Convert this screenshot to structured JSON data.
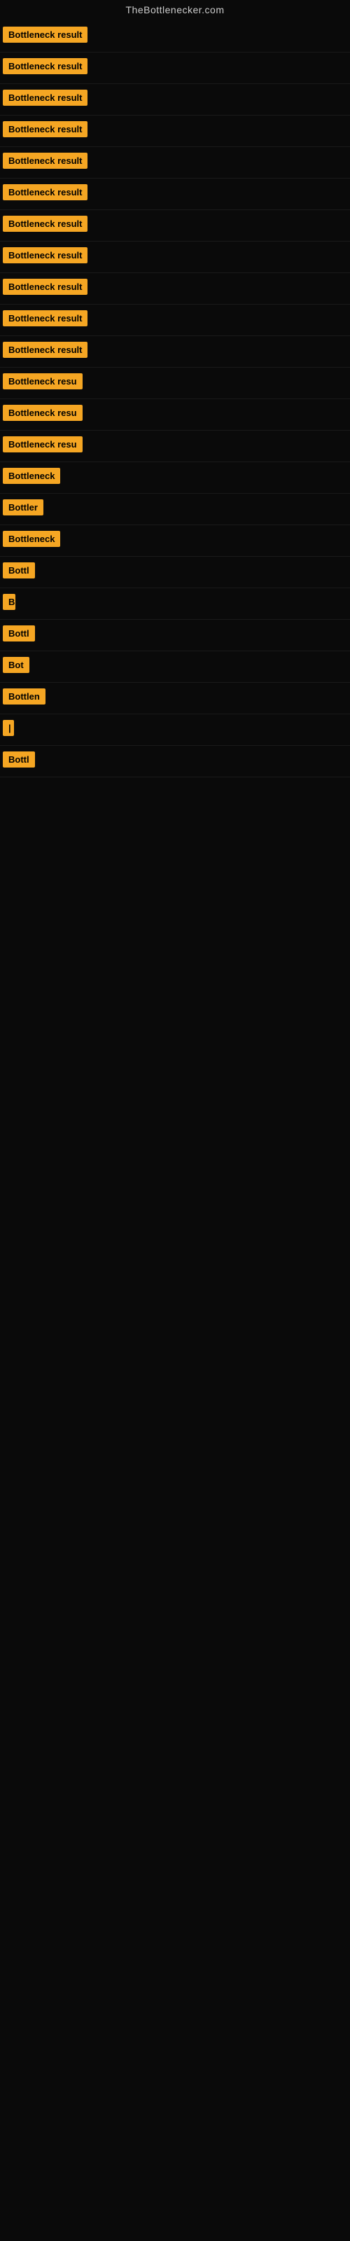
{
  "site": {
    "title": "TheBottlenecker.com"
  },
  "rows": [
    {
      "id": 1,
      "label": "Bottleneck result",
      "width": 155
    },
    {
      "id": 2,
      "label": "Bottleneck result",
      "width": 155
    },
    {
      "id": 3,
      "label": "Bottleneck result",
      "width": 155
    },
    {
      "id": 4,
      "label": "Bottleneck result",
      "width": 155
    },
    {
      "id": 5,
      "label": "Bottleneck result",
      "width": 155
    },
    {
      "id": 6,
      "label": "Bottleneck result",
      "width": 155
    },
    {
      "id": 7,
      "label": "Bottleneck result",
      "width": 155
    },
    {
      "id": 8,
      "label": "Bottleneck result",
      "width": 155
    },
    {
      "id": 9,
      "label": "Bottleneck result",
      "width": 150
    },
    {
      "id": 10,
      "label": "Bottleneck result",
      "width": 150
    },
    {
      "id": 11,
      "label": "Bottleneck result",
      "width": 150
    },
    {
      "id": 12,
      "label": "Bottleneck resu",
      "width": 130
    },
    {
      "id": 13,
      "label": "Bottleneck resu",
      "width": 125
    },
    {
      "id": 14,
      "label": "Bottleneck resu",
      "width": 120
    },
    {
      "id": 15,
      "label": "Bottleneck",
      "width": 90
    },
    {
      "id": 16,
      "label": "Bottler",
      "width": 65
    },
    {
      "id": 17,
      "label": "Bottleneck",
      "width": 85
    },
    {
      "id": 18,
      "label": "Bottl",
      "width": 50
    },
    {
      "id": 19,
      "label": "B",
      "width": 18
    },
    {
      "id": 20,
      "label": "Bottl",
      "width": 50
    },
    {
      "id": 21,
      "label": "Bot",
      "width": 38
    },
    {
      "id": 22,
      "label": "Bottlen",
      "width": 68
    },
    {
      "id": 23,
      "label": "|",
      "width": 12
    },
    {
      "id": 24,
      "label": "Bottl",
      "width": 50
    }
  ]
}
